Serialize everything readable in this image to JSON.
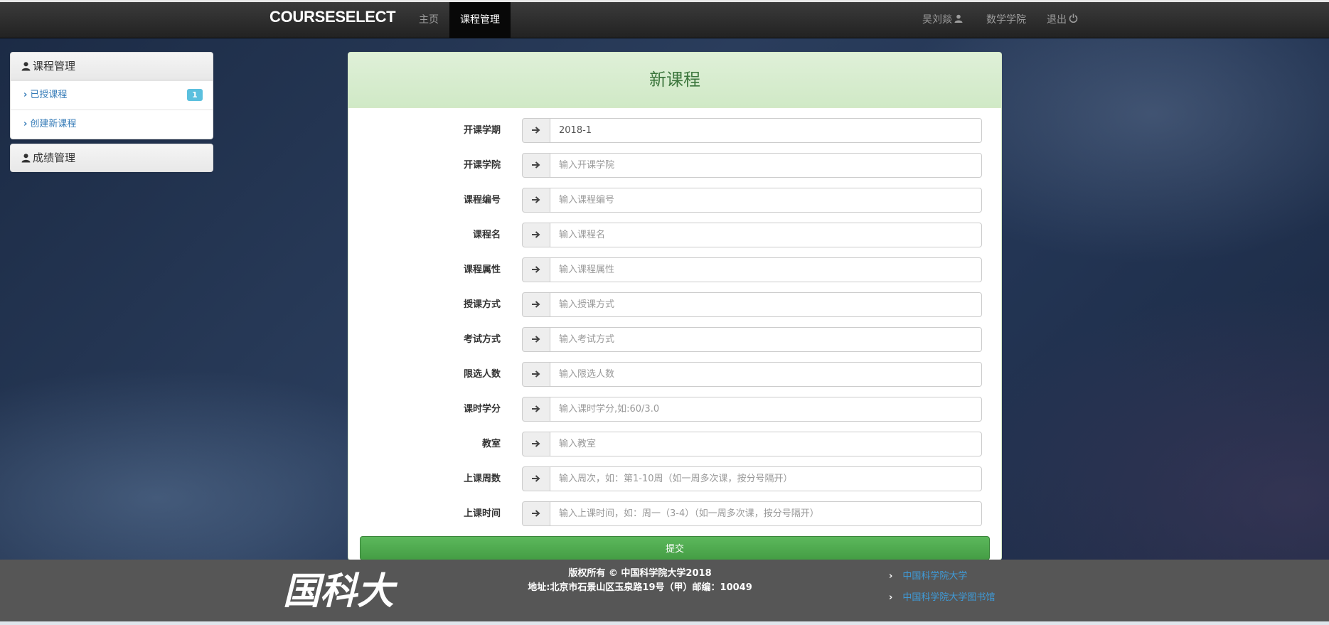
{
  "navbar": {
    "brand": "COURSESELECT",
    "links": [
      "主页",
      "课程管理"
    ],
    "user": "吴刘燚",
    "department": "数学学院",
    "logout": "退出"
  },
  "sidebar": {
    "course_panel": {
      "title": "课程管理",
      "items": [
        {
          "label": "已授课程",
          "badge": "1"
        },
        {
          "label": "创建新课程"
        }
      ]
    },
    "grade_panel": {
      "title": "成绩管理"
    }
  },
  "form": {
    "title": "新课程",
    "fields": [
      {
        "label": "开课学期",
        "value": "2018-1",
        "placeholder": ""
      },
      {
        "label": "开课学院",
        "value": "",
        "placeholder": "输入开课学院"
      },
      {
        "label": "课程编号",
        "value": "",
        "placeholder": "输入课程编号"
      },
      {
        "label": "课程名",
        "value": "",
        "placeholder": "输入课程名"
      },
      {
        "label": "课程属性",
        "value": "",
        "placeholder": "输入课程属性"
      },
      {
        "label": "授课方式",
        "value": "",
        "placeholder": "输入授课方式"
      },
      {
        "label": "考试方式",
        "value": "",
        "placeholder": "输入考试方式"
      },
      {
        "label": "限选人数",
        "value": "",
        "placeholder": "输入限选人数"
      },
      {
        "label": "课时学分",
        "value": "",
        "placeholder": "输入课时学分,如:60/3.0"
      },
      {
        "label": "教室",
        "value": "",
        "placeholder": "输入教室"
      },
      {
        "label": "上课周数",
        "value": "",
        "placeholder": "输入周次，如：第1-10周（如一周多次课，按分号隔开）"
      },
      {
        "label": "上课时间",
        "value": "",
        "placeholder": "输入上课时间，如：周一（3-4）（如一周多次课，按分号隔开）"
      }
    ],
    "submit": "提交"
  },
  "footer": {
    "logo_text": "国科大",
    "copyright": "版权所有 © 中国科学院大学2018",
    "address": "地址:北京市石景山区玉泉路19号（甲）邮编：10049",
    "links": [
      "中国科学院大学",
      "中国科学院大学图书馆"
    ]
  },
  "icons": {
    "user": "user-icon",
    "logout": "power-icon",
    "arrow": "arrow-right-icon",
    "chevron": "chevron-right-icon"
  },
  "colors": {
    "navbar": "#222222",
    "panel_success": "#dff0d8",
    "submit": "#5cb85c",
    "link": "#337ab7",
    "badge": "#5bc0de",
    "footer": "#565656"
  }
}
